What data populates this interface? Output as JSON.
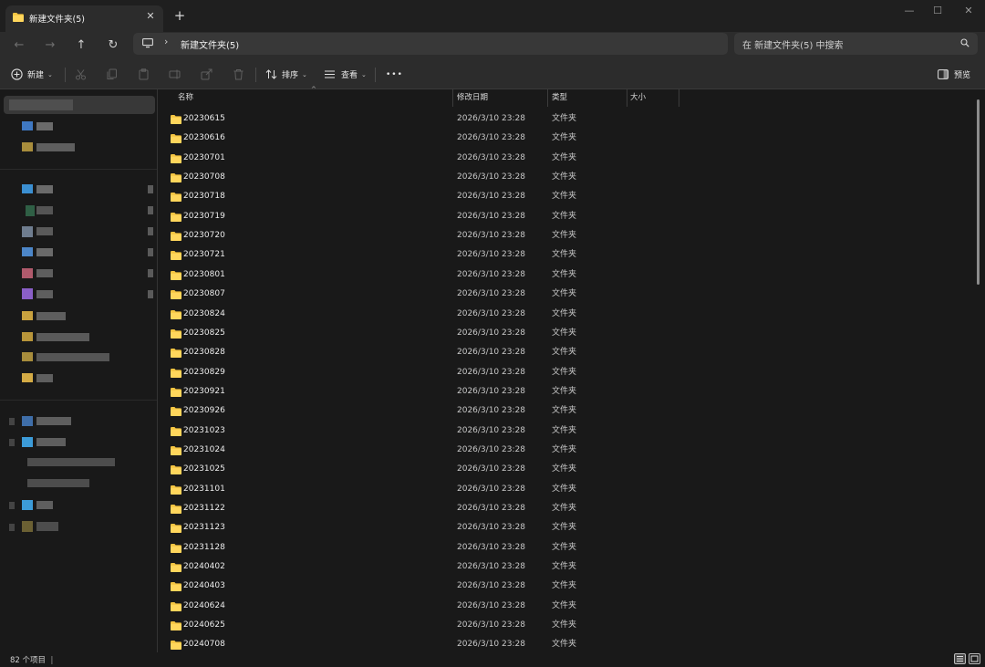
{
  "window": {
    "tab_title": "新建文件夹(5)",
    "tab_close": "✕",
    "new_tab": "+",
    "minimize": "—",
    "maximize": "☐",
    "close": "✕"
  },
  "nav": {
    "back": "←",
    "forward": "→",
    "up": "↑",
    "refresh": "↻",
    "breadcrumb_sep": "›",
    "address": "新建文件夹(5)",
    "search_placeholder": "在 新建文件夹(5) 中搜索"
  },
  "toolbar": {
    "new_label": "新建",
    "sort_label": "排序",
    "view_label": "查看",
    "more": "•••",
    "preview_label": "预览",
    "caret": "⌄"
  },
  "columns": {
    "name": "名称",
    "modified": "修改日期",
    "type": "类型",
    "size": "大小",
    "sort_indicator": "^"
  },
  "files": [
    {
      "name": "20230615",
      "modified": "2026/3/10 23:28",
      "type": "文件夹"
    },
    {
      "name": "20230616",
      "modified": "2026/3/10 23:28",
      "type": "文件夹"
    },
    {
      "name": "20230701",
      "modified": "2026/3/10 23:28",
      "type": "文件夹"
    },
    {
      "name": "20230708",
      "modified": "2026/3/10 23:28",
      "type": "文件夹"
    },
    {
      "name": "20230718",
      "modified": "2026/3/10 23:28",
      "type": "文件夹"
    },
    {
      "name": "20230719",
      "modified": "2026/3/10 23:28",
      "type": "文件夹"
    },
    {
      "name": "20230720",
      "modified": "2026/3/10 23:28",
      "type": "文件夹"
    },
    {
      "name": "20230721",
      "modified": "2026/3/10 23:28",
      "type": "文件夹"
    },
    {
      "name": "20230801",
      "modified": "2026/3/10 23:28",
      "type": "文件夹"
    },
    {
      "name": "20230807",
      "modified": "2026/3/10 23:28",
      "type": "文件夹"
    },
    {
      "name": "20230824",
      "modified": "2026/3/10 23:28",
      "type": "文件夹"
    },
    {
      "name": "20230825",
      "modified": "2026/3/10 23:28",
      "type": "文件夹"
    },
    {
      "name": "20230828",
      "modified": "2026/3/10 23:28",
      "type": "文件夹"
    },
    {
      "name": "20230829",
      "modified": "2026/3/10 23:28",
      "type": "文件夹"
    },
    {
      "name": "20230921",
      "modified": "2026/3/10 23:28",
      "type": "文件夹"
    },
    {
      "name": "20230926",
      "modified": "2026/3/10 23:28",
      "type": "文件夹"
    },
    {
      "name": "20231023",
      "modified": "2026/3/10 23:28",
      "type": "文件夹"
    },
    {
      "name": "20231024",
      "modified": "2026/3/10 23:28",
      "type": "文件夹"
    },
    {
      "name": "20231025",
      "modified": "2026/3/10 23:28",
      "type": "文件夹"
    },
    {
      "name": "20231101",
      "modified": "2026/3/10 23:28",
      "type": "文件夹"
    },
    {
      "name": "20231122",
      "modified": "2026/3/10 23:28",
      "type": "文件夹"
    },
    {
      "name": "20231123",
      "modified": "2026/3/10 23:28",
      "type": "文件夹"
    },
    {
      "name": "20231128",
      "modified": "2026/3/10 23:28",
      "type": "文件夹"
    },
    {
      "name": "20240402",
      "modified": "2026/3/10 23:28",
      "type": "文件夹"
    },
    {
      "name": "20240403",
      "modified": "2026/3/10 23:28",
      "type": "文件夹"
    },
    {
      "name": "20240624",
      "modified": "2026/3/10 23:28",
      "type": "文件夹"
    },
    {
      "name": "20240625",
      "modified": "2026/3/10 23:28",
      "type": "文件夹"
    },
    {
      "name": "20240708",
      "modified": "2026/3/10 23:28",
      "type": "文件夹"
    }
  ],
  "status": {
    "item_count": "82 个项目",
    "cursor": "|"
  },
  "colors": {
    "folder": "#f4c542",
    "background": "#191919",
    "toolbar": "#2c2c2c"
  },
  "icons": {
    "folder": "folder-icon",
    "pc": "computer-icon",
    "search": "search-icon",
    "new": "plus-circle-icon",
    "cut": "scissors-icon",
    "copy": "copy-icon",
    "paste": "paste-icon",
    "rename": "rename-icon",
    "share": "share-icon",
    "delete": "trash-icon",
    "sort": "sort-icon",
    "view": "view-icon",
    "preview": "preview-pane-icon"
  }
}
